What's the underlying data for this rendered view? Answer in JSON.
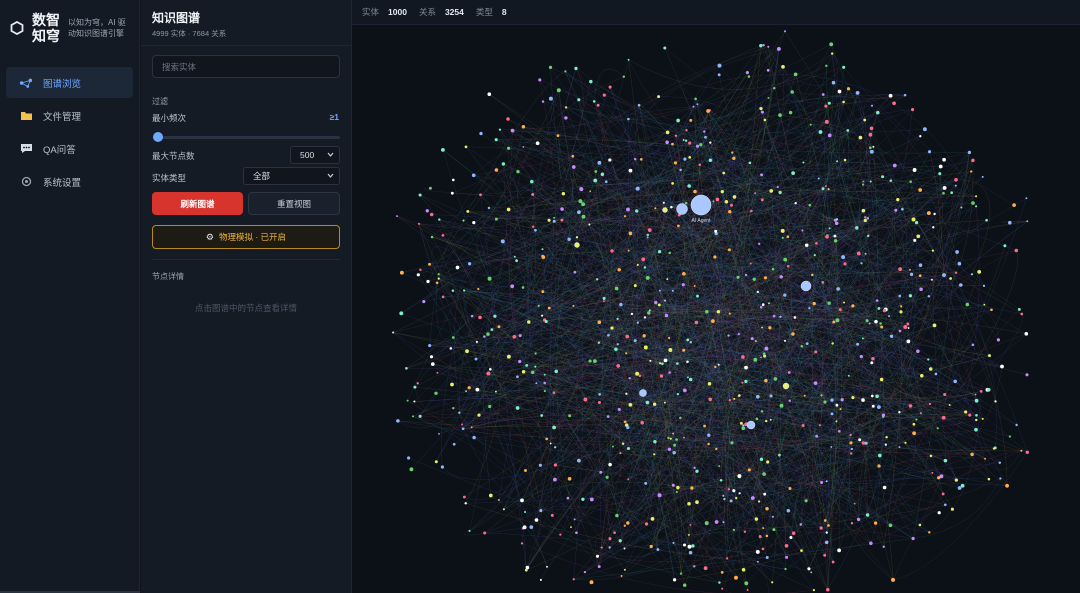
{
  "brand": {
    "name": "数智知穹",
    "slogan": "以知为穹，AI 驱动知识图谱引擎"
  },
  "nav": {
    "items": [
      {
        "label": "图谱浏览",
        "icon": "graph-icon",
        "active": true
      },
      {
        "label": "文件管理",
        "icon": "folder-icon",
        "active": false
      },
      {
        "label": "QA问答",
        "icon": "chat-icon",
        "active": false
      },
      {
        "label": "系统设置",
        "icon": "settings-icon",
        "active": false
      }
    ]
  },
  "panel": {
    "title": "知识图谱",
    "subtitle": "4999 实体 · 7684 关系",
    "search_placeholder": "搜索实体",
    "filter_title": "过滤",
    "min_freq_label": "最小频次",
    "min_freq_value": "≥1",
    "max_nodes_label": "最大节点数",
    "max_nodes_value": "500",
    "entity_type_label": "实体类型",
    "entity_type_value": "全部",
    "refresh_label": "刷新图谱",
    "reset_label": "重置视图",
    "physics_label": "物理模拟 · 已开启",
    "details_title": "节点详情",
    "details_empty": "点击图谱中的节点查看详情"
  },
  "stats": {
    "entities_key": "实体",
    "entities_val": "1000",
    "relations_key": "关系",
    "relations_val": "3254",
    "types_key": "类型",
    "types_val": "8"
  },
  "graph": {
    "highlight_label": "AI Agent",
    "colors": {
      "accent": "#6ea8ff",
      "danger": "#d6342c",
      "warning": "#f0b73a",
      "node_palette": [
        "#8fb8ff",
        "#e9f06a",
        "#7ef0c8",
        "#c98cff",
        "#ff6b8a",
        "#69d36b",
        "#ffffff",
        "#ffb04a"
      ]
    }
  }
}
